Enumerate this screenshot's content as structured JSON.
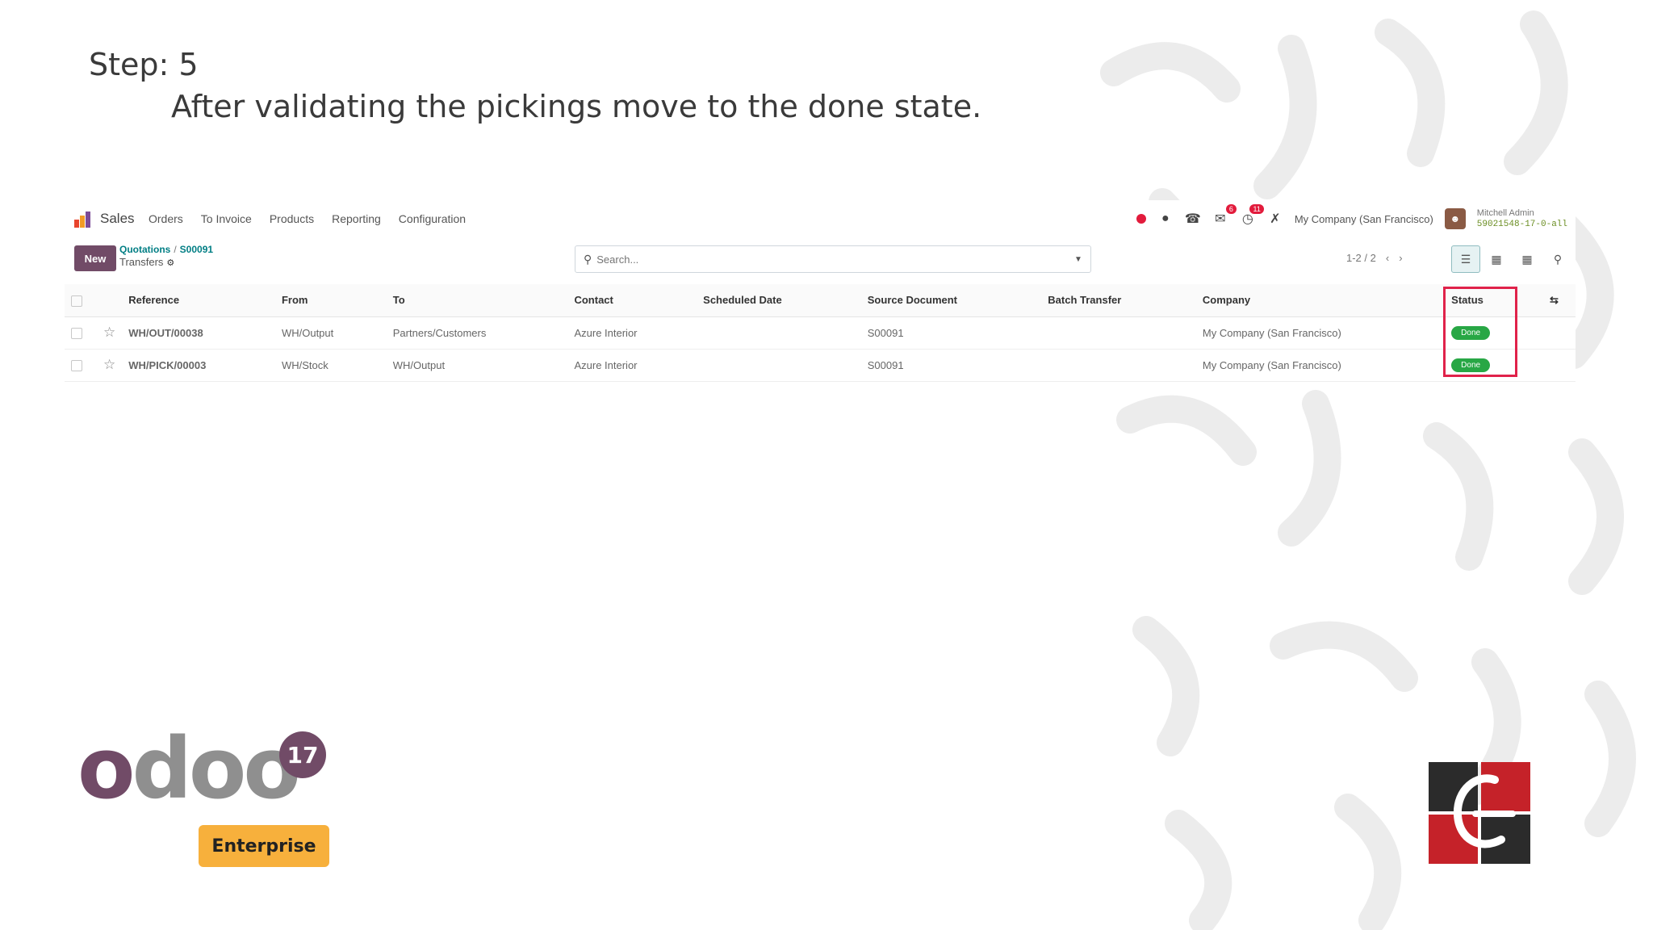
{
  "step": {
    "title": "Step: 5",
    "description": "After validating the pickings move to the done state."
  },
  "navbar": {
    "app_name": "Sales",
    "menu": [
      "Orders",
      "To Invoice",
      "Products",
      "Reporting",
      "Configuration"
    ],
    "messages_count": "6",
    "activities_count": "11",
    "company": "My Company (San Francisco)",
    "user_name": "Mitchell Admin",
    "database": "59021548-17-0-all"
  },
  "control": {
    "new_label": "New",
    "breadcrumb_parent": "Quotations",
    "breadcrumb_record": "S00091",
    "page_title": "Transfers",
    "search_placeholder": "Search...",
    "pager": "1-2 / 2"
  },
  "table": {
    "headers": {
      "reference": "Reference",
      "from": "From",
      "to": "To",
      "contact": "Contact",
      "scheduled_date": "Scheduled Date",
      "source_document": "Source Document",
      "batch_transfer": "Batch Transfer",
      "company": "Company",
      "status": "Status"
    },
    "rows": [
      {
        "reference": "WH/OUT/00038",
        "from": "WH/Output",
        "to": "Partners/Customers",
        "contact": "Azure Interior",
        "scheduled_date": "",
        "source_document": "S00091",
        "batch_transfer": "",
        "company": "My Company (San Francisco)",
        "status": "Done"
      },
      {
        "reference": "WH/PICK/00003",
        "from": "WH/Stock",
        "to": "WH/Output",
        "contact": "Azure Interior",
        "scheduled_date": "",
        "source_document": "S00091",
        "batch_transfer": "",
        "company": "My Company (San Francisco)",
        "status": "Done"
      }
    ]
  },
  "branding": {
    "odoo_version": "17",
    "edition": "Enterprise",
    "odoo_color": "#714b67",
    "enterprise_color": "#f7b03c",
    "done_color": "#28a745",
    "highlight_color": "#e0224a"
  }
}
